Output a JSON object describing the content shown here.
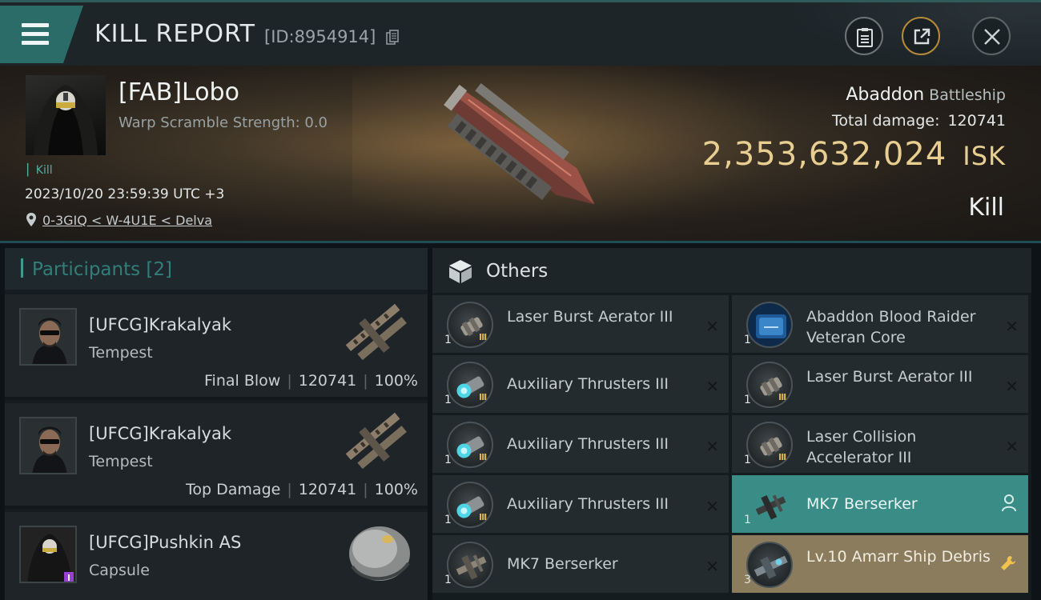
{
  "header": {
    "title": "KILL REPORT",
    "kill_id": "[ID:8954914]"
  },
  "victim": {
    "name": "[FAB]Lobo",
    "subtitle": "Warp Scramble Strength: 0.0",
    "kill_label": "Kill",
    "datetime": "2023/10/20 23:59:39 UTC +3",
    "location": "0-3GIQ < W-4U1E < Delva",
    "ship_name": "Abaddon",
    "ship_class": "Battleship",
    "total_damage_label": "Total damage:",
    "total_damage": "120741",
    "isk_value": "2,353,632,024",
    "isk_unit": "ISK",
    "result": "Kill"
  },
  "participants": {
    "title": "Participants",
    "count": "[2]",
    "rows": [
      {
        "name": "[UFCG]Krakalyak",
        "ship": "Tempest",
        "role": "Final Blow",
        "damage": "120741",
        "percent": "100%"
      },
      {
        "name": "[UFCG]Krakalyak",
        "ship": "Tempest",
        "role": "Top Damage",
        "damage": "120741",
        "percent": "100%"
      },
      {
        "name": "[UFCG]Pushkin AS",
        "ship": "Capsule"
      }
    ]
  },
  "others": {
    "title": "Others",
    "items": [
      {
        "name": "Laser Burst Aerator III",
        "qty": "1",
        "level": "III",
        "action": "✕"
      },
      {
        "name": "Abaddon Blood Raider Veteran Core",
        "qty": "1",
        "action": "✕"
      },
      {
        "name": "Auxiliary Thrusters III",
        "qty": "1",
        "level": "III",
        "action": "✕"
      },
      {
        "name": "Laser Burst Aerator III",
        "qty": "1",
        "level": "III",
        "action": "✕"
      },
      {
        "name": "Auxiliary Thrusters III",
        "qty": "1",
        "level": "III",
        "action": "✕"
      },
      {
        "name": "Laser Collision Accelerator III",
        "qty": "1",
        "level": "III",
        "action": "✕"
      },
      {
        "name": "Auxiliary Thrusters III",
        "qty": "1",
        "level": "III",
        "action": "✕"
      },
      {
        "name": "MK7  Berserker",
        "qty": "1",
        "action": "person"
      },
      {
        "name": "MK7  Berserker",
        "qty": "1",
        "action": "✕"
      },
      {
        "name": "Lv.10 Amarr Ship Debris",
        "qty": "3",
        "action": "wrench"
      }
    ]
  },
  "colors": {
    "accent_teal": "#3a8c86",
    "gold_row": "#8a7c5c",
    "isk_gold": "#e8cf91",
    "participants_accent": "#317e7a"
  }
}
